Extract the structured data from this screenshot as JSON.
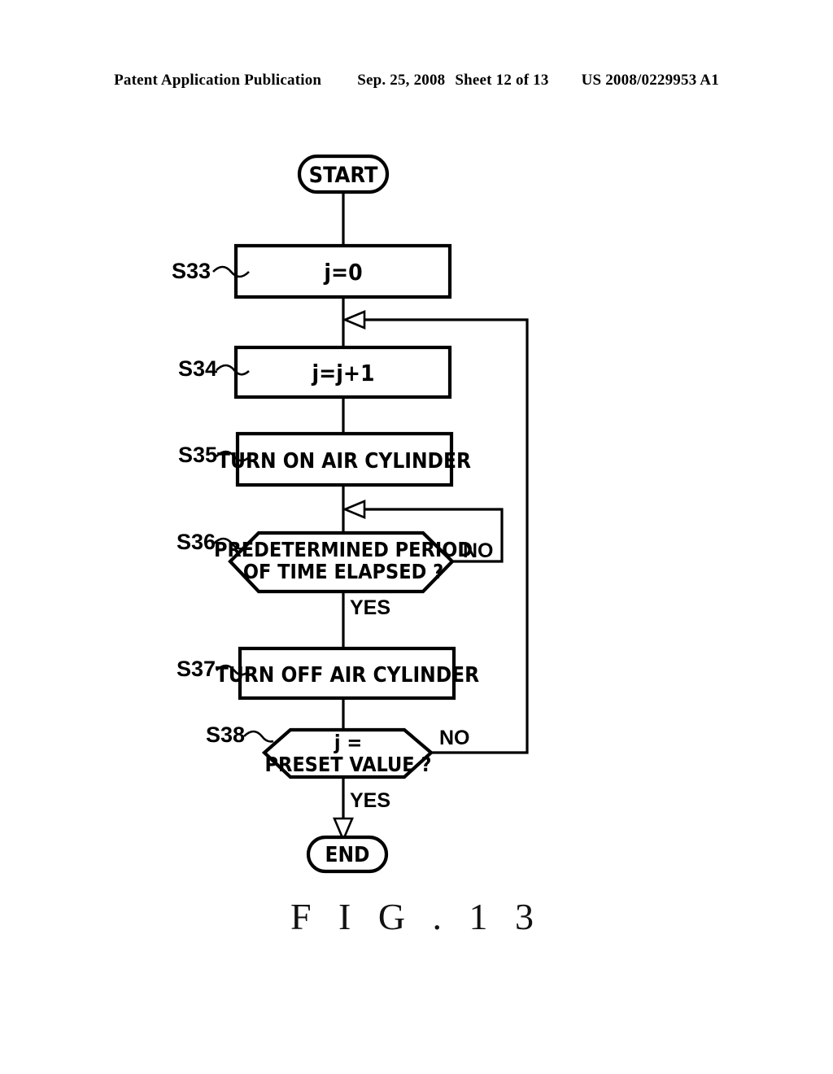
{
  "header": {
    "publication": "Patent Application Publication",
    "date": "Sep. 25, 2008",
    "sheet": "Sheet 12 of 13",
    "patent_number": "US 2008/0229953 A1"
  },
  "figure": {
    "caption": "F I G . 1 3"
  },
  "flowchart": {
    "start_label": "START",
    "end_label": "END",
    "steps": [
      {
        "id": "S33",
        "tag": "S33",
        "text": "j=0",
        "shape": "process"
      },
      {
        "id": "S34",
        "tag": "S34",
        "text": "j=j+1",
        "shape": "process"
      },
      {
        "id": "S35",
        "tag": "S35",
        "text": "TURN ON AIR CYLINDER",
        "shape": "process"
      },
      {
        "id": "S36",
        "tag": "S36",
        "line1": "PREDETERMINED PERIOD",
        "line2": "OF TIME ELAPSED ?",
        "shape": "decision"
      },
      {
        "id": "S37",
        "tag": "S37",
        "text": "TURN OFF AIR CYLINDER",
        "shape": "process"
      },
      {
        "id": "S38",
        "tag": "S38",
        "line1": "j =",
        "line2": "PRESET VALUE ?",
        "shape": "decision"
      }
    ],
    "branch_labels": {
      "s36_no": "NO",
      "s36_yes": "YES",
      "s38_no": "NO",
      "s38_yes": "YES"
    },
    "colors": {
      "stroke": "#000000",
      "fill": "#ffffff"
    }
  }
}
